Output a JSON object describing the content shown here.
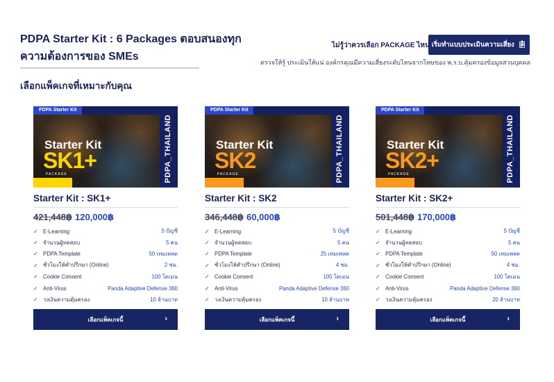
{
  "header": {
    "headline": "PDPA Starter Kit : 6 Packages ตอบสนองทุกความต้องการของ SMEs",
    "subhead": "เลือกแพ็คเกจที่เหมาะกับคุณ"
  },
  "assessment": {
    "question": "ไม่รู้ว่าควรเลือก PACKAGE ไหน?",
    "button_label": "เริ่มทำแบบประเมินความเสี่ยง",
    "button_icon": "clipboard-icon",
    "note": "ตรวจให้รู้ ประเมินให้แน่ องค์กรคุณมีความเสี่ยงระดับไหนจากโทษของ พ.ร.บ.คุ้มครองข้อมูลส่วนบุคคล"
  },
  "colors": {
    "navy": "#1b2a6b",
    "price_blue": "#2749b8",
    "tag_blue": "#2f46c9"
  },
  "cards": [
    {
      "banner": {
        "tag": "PDPA Starter Kit",
        "kit": "Starter Kit",
        "code": "SK1+",
        "pkg": "PACKAGE",
        "side": "PDPA_THAILAND",
        "accent": "#ffd500"
      },
      "title": "Starter Kit : SK1+",
      "old_price": "421,448฿",
      "new_price": "120,000฿",
      "features": [
        {
          "label": "E-Learning",
          "value": "5 บัญชี"
        },
        {
          "label": "จำนวนผู้ทดสอบ",
          "value": "5 คน"
        },
        {
          "label": "PDPA Template",
          "value": "50 เทมเพลต"
        },
        {
          "label": "ชั่วโมงให้คำปรึกษา (Online)",
          "value": "2 ชม."
        },
        {
          "label": "Cookie Consent",
          "value": "100 โดเมน"
        },
        {
          "label": "Anti-Virus",
          "value": "Panda Adaptive Defense 360"
        },
        {
          "label": "วงเงินความคุ้มครอง",
          "value": "10 ล้านบาท"
        }
      ],
      "button_label": "เลือกแพ็คเกจนี้"
    },
    {
      "banner": {
        "tag": "PDPA Starter Kit",
        "kit": "Starter Kit",
        "code": "SK2",
        "pkg": "PACKAGE",
        "side": "PDPA_THAILAND",
        "accent": "#f79a1e"
      },
      "title": "Starter Kit : SK2",
      "old_price": "346,448฿",
      "new_price": "60,000฿",
      "features": [
        {
          "label": "E-Learning",
          "value": "5 บัญชี"
        },
        {
          "label": "จำนวนผู้ทดสอบ",
          "value": "5 คน"
        },
        {
          "label": "PDPA Template",
          "value": "25 เทมเพลต"
        },
        {
          "label": "ชั่วโมงให้คำปรึกษา (Online)",
          "value": "4 ชม."
        },
        {
          "label": "Cookie Consent",
          "value": "100 โดเมน"
        },
        {
          "label": "Anti-Virus",
          "value": "Panda Adaptive Defense 360"
        },
        {
          "label": "วงเงินความคุ้มครอง",
          "value": "10 ล้านบาท"
        }
      ],
      "button_label": "เลือกแพ็คเกจนี้"
    },
    {
      "banner": {
        "tag": "PDPA Starter Kit",
        "kit": "Starter Kit",
        "code": "SK2+",
        "pkg": "PACKAGE",
        "side": "PDPA_THAILAND",
        "accent": "#f79a1e"
      },
      "title": "Starter Kit : SK2+",
      "old_price": "501,448฿",
      "new_price": "170,000฿",
      "features": [
        {
          "label": "E-Learning",
          "value": "5 บัญชี"
        },
        {
          "label": "จำนวนผู้ทดสอบ",
          "value": "5 คน"
        },
        {
          "label": "PDPA Template",
          "value": "50 เทมเพลต"
        },
        {
          "label": "ชั่วโมงให้คำปรึกษา (Online)",
          "value": "4 ชม."
        },
        {
          "label": "Cookie Consent",
          "value": "100 โดเมน"
        },
        {
          "label": "Anti-Virus",
          "value": "Panda Adaptive Defense 360"
        },
        {
          "label": "วงเงินความคุ้มครอง",
          "value": "20 ล้านบาท"
        }
      ],
      "button_label": "เลือกแพ็คเกจนี้"
    }
  ]
}
